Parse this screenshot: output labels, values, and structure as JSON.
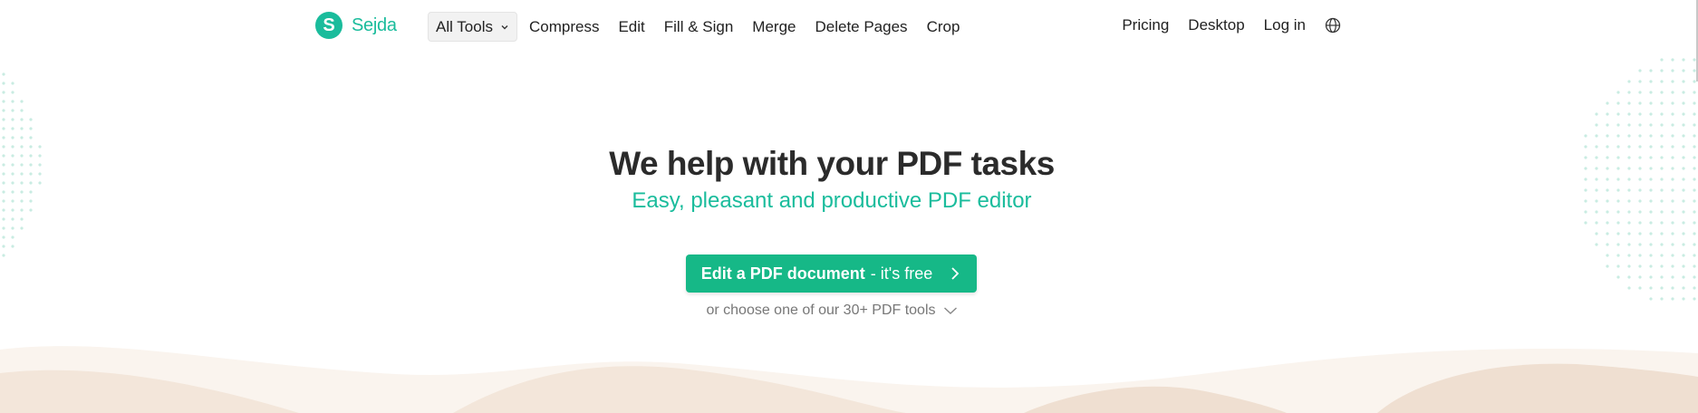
{
  "brand": {
    "logo_letter": "S",
    "name": "Sejda",
    "accent": "#1abc9c",
    "button_color": "#16b887"
  },
  "nav": {
    "all_tools_label": "All Tools",
    "links": [
      "Compress",
      "Edit",
      "Fill & Sign",
      "Merge",
      "Delete Pages",
      "Crop"
    ],
    "right_links": [
      "Pricing",
      "Desktop",
      "Log in"
    ],
    "language_icon": "globe-icon"
  },
  "hero": {
    "title": "We help with your PDF tasks",
    "subtitle": "Easy, pleasant and productive PDF editor",
    "cta_strong": "Edit a PDF document",
    "cta_light": "- it's free",
    "more_tools": "or choose one of our 30+ PDF tools"
  },
  "colors": {
    "wave_light": "#faf4ee",
    "wave_mid": "#f3e6da",
    "wave_dark": "#efdfd1",
    "dots": "#c9ece2"
  }
}
